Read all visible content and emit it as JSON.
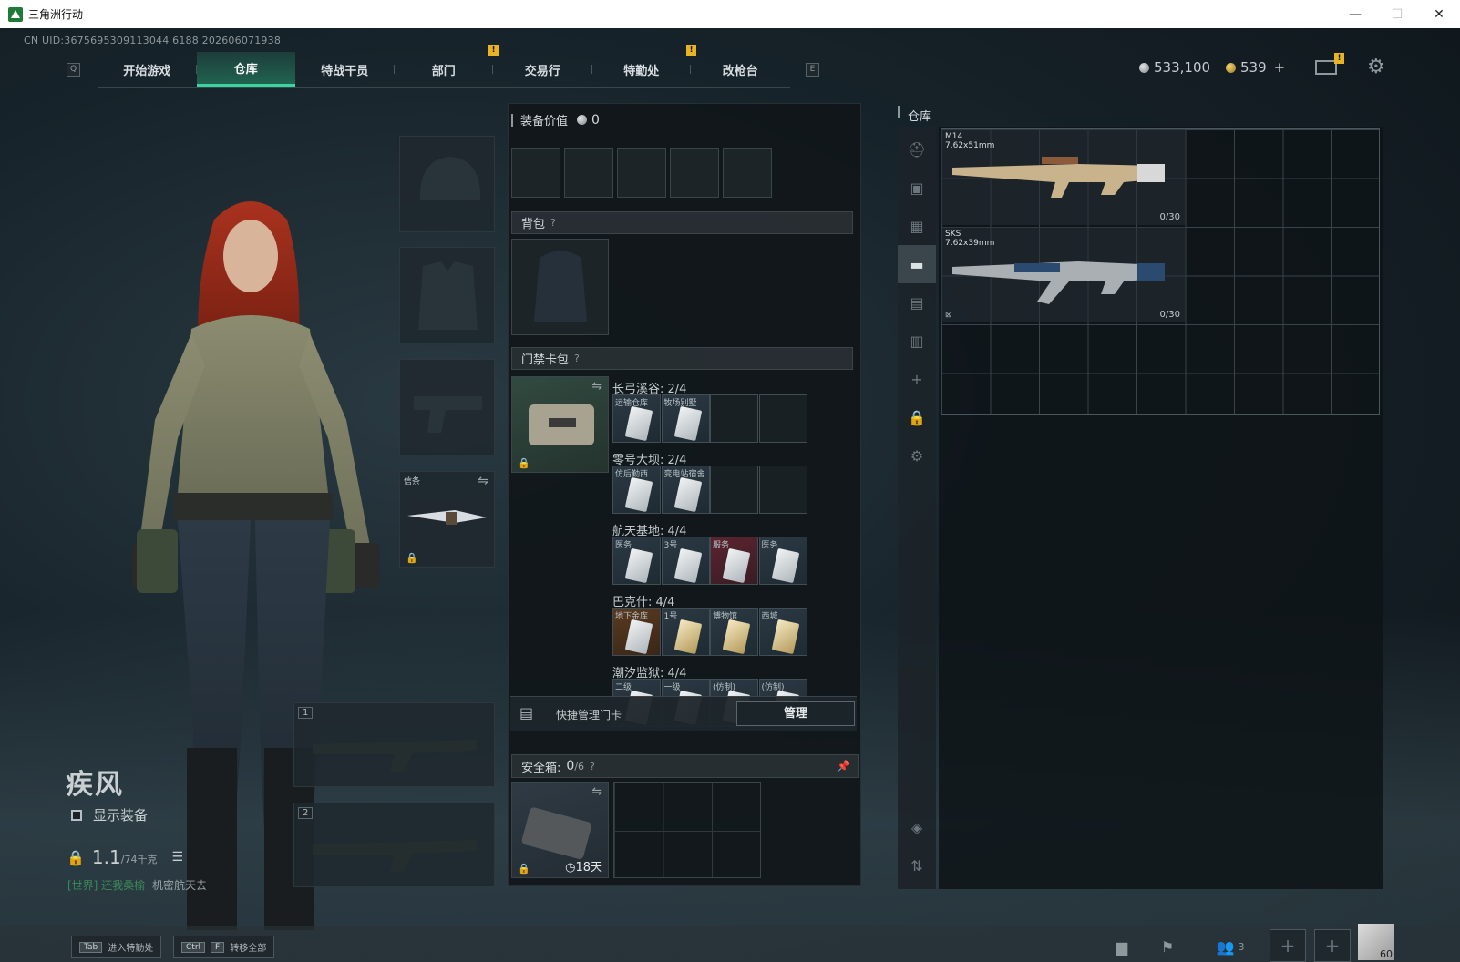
{
  "window": {
    "title": "三角洲行动",
    "controls": [
      "—",
      "☐",
      "✕"
    ]
  },
  "uid": "CN UID:3675695309113044 6188 202606071938",
  "nav": {
    "key_left": "Q",
    "key_right": "E",
    "tabs": [
      {
        "label": "开始游戏",
        "active": false,
        "alert": false
      },
      {
        "label": "仓库",
        "active": true,
        "alert": false
      },
      {
        "label": "特战干员",
        "active": false,
        "alert": false
      },
      {
        "label": "部门",
        "active": false,
        "alert": true
      },
      {
        "label": "交易行",
        "active": false,
        "alert": false
      },
      {
        "label": "特勤处",
        "active": false,
        "alert": true
      },
      {
        "label": "改枪台",
        "active": false,
        "alert": false
      }
    ],
    "alert_mark": "!"
  },
  "currency": {
    "silver": "533,100",
    "gold": "539",
    "gold_add": "+"
  },
  "header_icons": {
    "mail_alert": "!",
    "mail": "mail-icon",
    "settings": "gear-icon"
  },
  "character": {
    "name": "疾风",
    "show_equipment_label": "显示装备",
    "weight_value": "1.1",
    "weight_capacity": "/74千克",
    "chat_channel": "[世界]",
    "chat_user": "还我桑榆",
    "chat_text": "机密航天去"
  },
  "equip_slots": {
    "melee_label": "信条",
    "weapon1_index": "1",
    "weapon2_index": "2"
  },
  "loadout": {
    "value_label": "装备价值",
    "value": "0",
    "backpack_label": "背包",
    "backpack_help": "?",
    "keycard_label": "门禁卡包",
    "keycard_help": "?",
    "quick_manage_label": "快捷管理门卡",
    "manage_button": "管理",
    "safebox_label": "安全箱:",
    "safebox_count": "0",
    "safebox_cap": "/6",
    "safebox_help": "?",
    "safebox_days": "18天",
    "maps": [
      {
        "title": "长弓溪谷: 2/4",
        "cards": [
          {
            "label": "运输仓库",
            "style": "normal"
          },
          {
            "label": "牧场别墅",
            "style": "normal"
          },
          {
            "label": "",
            "style": "empty"
          },
          {
            "label": "",
            "style": "empty"
          }
        ]
      },
      {
        "title": "零号大坝: 2/4",
        "cards": [
          {
            "label": "仿后勤西",
            "style": "normal"
          },
          {
            "label": "变电站宿舍",
            "style": "normal"
          },
          {
            "label": "",
            "style": "empty"
          },
          {
            "label": "",
            "style": "empty"
          }
        ]
      },
      {
        "title": "航天基地: 4/4",
        "cards": [
          {
            "label": "医务",
            "style": "normal"
          },
          {
            "label": "3号",
            "style": "normal"
          },
          {
            "label": "服务",
            "style": "red"
          },
          {
            "label": "医务",
            "style": "normal"
          }
        ]
      },
      {
        "title": "巴克什: 4/4",
        "cards": [
          {
            "label": "地下金库",
            "style": "goldbg"
          },
          {
            "label": "1号",
            "style": "gold"
          },
          {
            "label": "博物馆",
            "style": "gold"
          },
          {
            "label": "西城",
            "style": "gold"
          }
        ]
      },
      {
        "title": "潮汐监狱: 4/4",
        "cards": [
          {
            "label": "二级",
            "style": "normal"
          },
          {
            "label": "一级",
            "style": "normal"
          },
          {
            "label": "(仿制)",
            "style": "normal"
          },
          {
            "label": "(仿制)",
            "style": "normal"
          }
        ]
      }
    ]
  },
  "warehouse": {
    "title": "仓库",
    "items": [
      {
        "name": "M14",
        "caliber": "7.62x51mm",
        "ammo": "0/30"
      },
      {
        "name": "SKS",
        "caliber": "7.62x39mm",
        "ammo": "0/30"
      }
    ],
    "side_icons": [
      "helmet-icon",
      "armor-icon",
      "rig-icon",
      "weapon-icon",
      "ammo-icon",
      "medical-icon",
      "add-icon",
      "lock-icon",
      "settings-icon",
      "stack-icon",
      "transfer-icon"
    ]
  },
  "bottom": {
    "hint1_key": "Tab",
    "hint1_text": "进入特勤处",
    "hint2_key1": "Ctrl",
    "hint2_key2": "F",
    "hint2_text": "转移全部",
    "squad_count": "3",
    "level": "60"
  }
}
